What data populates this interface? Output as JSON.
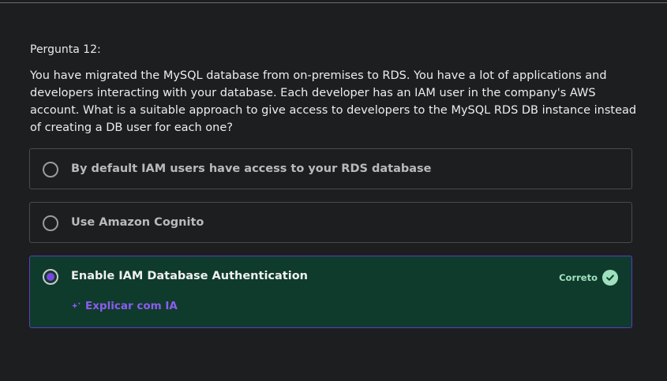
{
  "question": {
    "number_label": "Pergunta 12:",
    "text": "You have migrated the MySQL database from on-premises to RDS. You have a lot of applications and developers interacting with your database. Each developer has an IAM user in the company's AWS account. What is a suitable approach to give access to developers to the MySQL RDS DB instance instead of creating a DB user for each one?"
  },
  "options": [
    {
      "label": "By default IAM users have access to your RDS database",
      "selected": false
    },
    {
      "label": "Use Amazon Cognito",
      "selected": false
    },
    {
      "label": "Enable IAM Database Authentication",
      "selected": true
    }
  ],
  "result": {
    "status_label": "Correto",
    "status_icon": "check-circle-icon"
  },
  "explain": {
    "label": "Explicar com IA",
    "icon": "sparkle-icon"
  },
  "colors": {
    "background": "#1d1e20",
    "selected_bg": "#0f3b2c",
    "selected_border": "#5b3dc8",
    "accent_purple": "#8c5cf0",
    "correct_green": "#9fe0bf"
  }
}
